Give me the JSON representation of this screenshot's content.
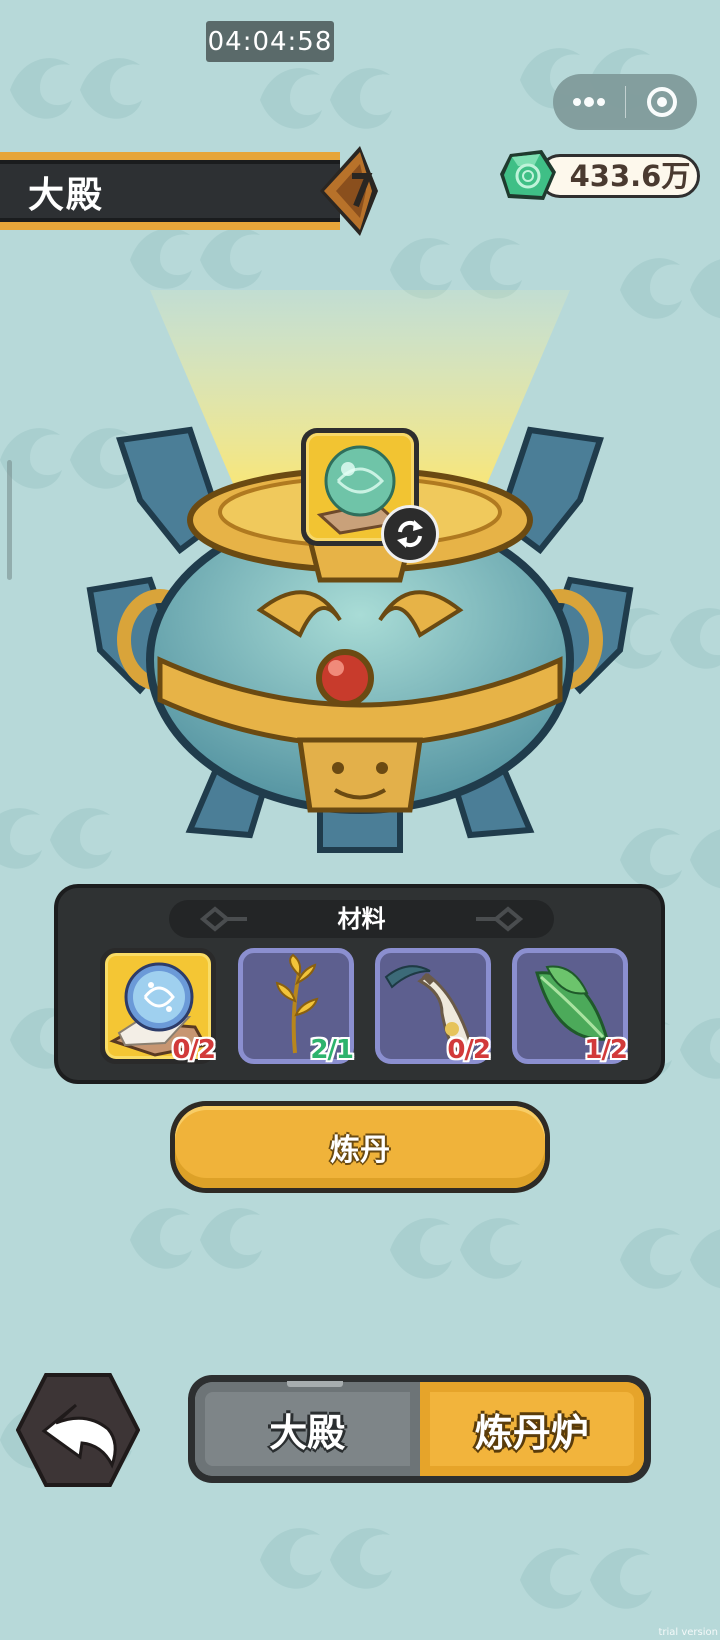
{
  "status_bar": {
    "time": "04:04:58"
  },
  "capsule": {
    "more_icon": "more-dots-icon",
    "close_icon": "target-circle-icon"
  },
  "header": {
    "title": "大殿"
  },
  "currency": {
    "icon": "jade-gem-icon",
    "value": "433.6万"
  },
  "furnace": {
    "selected_item": "jade-orb",
    "refresh_icon": "refresh-icon"
  },
  "materials": {
    "title": "材料",
    "items": [
      {
        "icon": "spirit-orb-icon",
        "count": "0/2",
        "status": "insufficient",
        "selected": true
      },
      {
        "icon": "golden-herb-icon",
        "count": "2/1",
        "status": "sufficient",
        "selected": false
      },
      {
        "icon": "feather-vase-icon",
        "count": "0/2",
        "status": "insufficient",
        "selected": false
      },
      {
        "icon": "green-leaf-icon",
        "count": "1/2",
        "status": "insufficient",
        "selected": false
      }
    ]
  },
  "action": {
    "alchemy_label": "炼丹"
  },
  "bottom": {
    "back_icon": "back-arrow-icon",
    "tabs": [
      {
        "label": "大殿",
        "active": false
      },
      {
        "label": "炼丹炉",
        "active": true
      }
    ]
  },
  "watermark": "trial version",
  "colors": {
    "background": "#b7d9d9",
    "accent": "#f2b43c",
    "count_red": "#d23a3a",
    "count_green": "#2eb36d"
  }
}
